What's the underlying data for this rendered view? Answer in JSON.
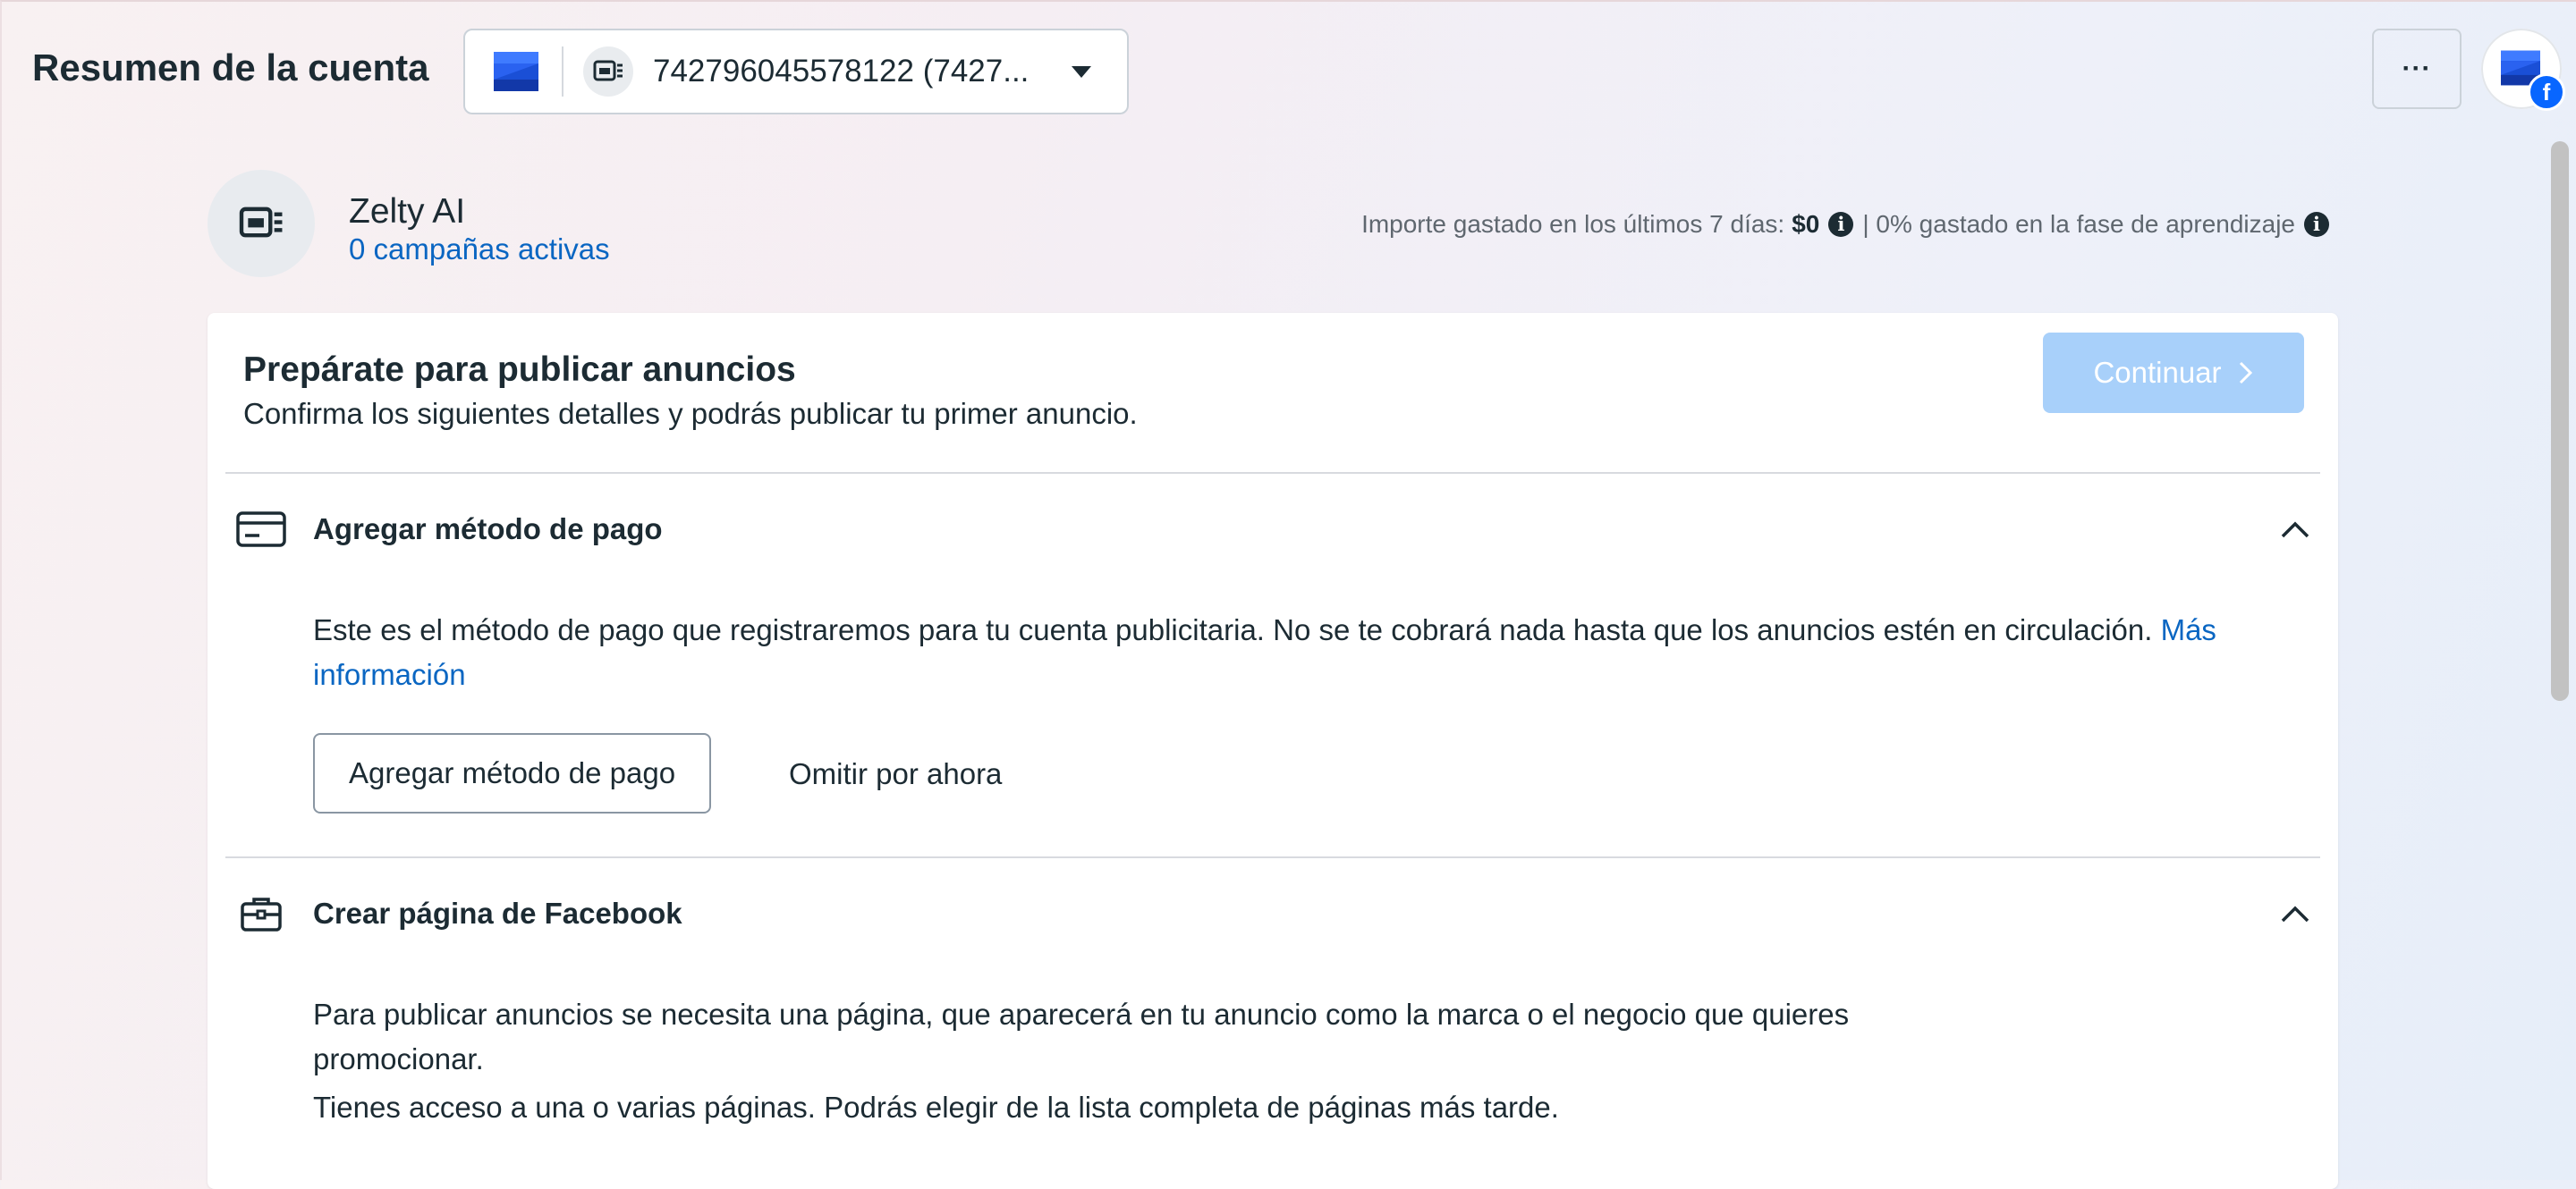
{
  "header": {
    "page_title": "Resumen de la cuenta",
    "account_selector": "742796045578122 (7427...",
    "more_label": "···"
  },
  "account": {
    "name": "Zelty AI",
    "campaigns": "0 campañas activas",
    "stats_prefix": "Importe gastado en los últimos 7 días:",
    "stats_amount": "$0",
    "stats_learning": "| 0% gastado en la fase de aprendizaje"
  },
  "card": {
    "title": "Prepárate para publicar anuncios",
    "subtitle": "Confirma los siguientes detalles y podrás publicar tu primer anuncio.",
    "continue_label": "Continuar"
  },
  "payment_section": {
    "title": "Agregar método de pago",
    "description": "Este es el método de pago que registraremos para tu cuenta publicitaria. No se te cobrará nada hasta que los anuncios estén en circulación.",
    "link": "Más información",
    "add_button": "Agregar método de pago",
    "skip_button": "Omitir por ahora"
  },
  "page_section": {
    "title": "Crear página de Facebook",
    "description": "Para publicar anuncios se necesita una página, que aparecerá en tu anuncio como la marca o el negocio que quieres promocionar.",
    "access_note": "Tienes acceso a una o varias páginas. Podrás elegir de la lista completa de páginas más tarde."
  },
  "colors": {
    "link": "#0a66c2",
    "continue_disabled": "#a8d0fa",
    "facebook": "#0866ff",
    "brand_blue": "#1a4fd6"
  }
}
